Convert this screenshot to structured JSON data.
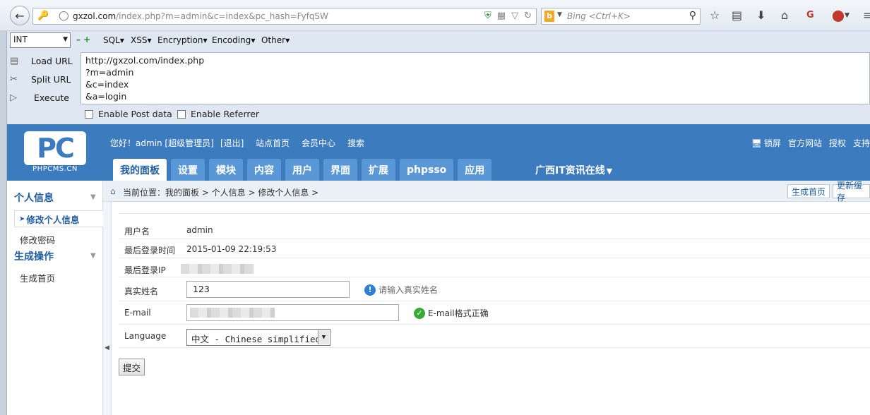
{
  "browser": {
    "url_host": "gxzol.com",
    "url_rest": "/index.php?m=admin&c=index&pc_hash=FyfqSW",
    "search_placeholder": "Bing <Ctrl+K>",
    "search_engine": "b"
  },
  "hackbar": {
    "selected": "INT",
    "menus": [
      "SQL",
      "XSS",
      "Encryption",
      "Encoding",
      "Other"
    ],
    "actions": [
      "Load URL",
      "Split URL",
      "Execute"
    ],
    "textarea": "http://gxzol.com/index.php\n?m=admin\n&c=index\n&a=login",
    "checkboxes": [
      "Enable Post data",
      "Enable Referrer"
    ]
  },
  "cms": {
    "logo_mark": "PC",
    "logo_text": "PHPCMS.CN",
    "greeting": "您好！admin [超级管理员]",
    "top_links": [
      "[退出]",
      "站点首页",
      "会员中心",
      "搜索"
    ],
    "right_links": [
      "锁屏",
      "官方网站",
      "授权",
      "支持"
    ],
    "tabs": [
      "我的面板",
      "设置",
      "模块",
      "内容",
      "用户",
      "界面",
      "扩展",
      "phpsso",
      "应用"
    ],
    "site_select": "广西IT资讯在线"
  },
  "sidebar": {
    "section1": "个人信息",
    "active_item": "修改个人信息",
    "item2": "修改密码",
    "section2": "生成操作",
    "item3": "生成首页"
  },
  "breadcrumb": {
    "text": "当前位置：我的面板 > 个人信息 > 修改个人信息 >",
    "btn1": "生成首页",
    "btn2": "更新缓存"
  },
  "form": {
    "username_label": "用户名",
    "username": "admin",
    "last_login_label": "最后登录时间",
    "last_login": "2015-01-09 22:19:53",
    "last_ip_label": "最后登录IP",
    "realname_label": "真实姓名",
    "realname": "123",
    "realname_hint": "请输入真实姓名",
    "email_label": "E-mail",
    "email_hint": "E-mail格式正确",
    "language_label": "Language",
    "language": "中文 - Chinese simplified",
    "submit": "提交"
  }
}
